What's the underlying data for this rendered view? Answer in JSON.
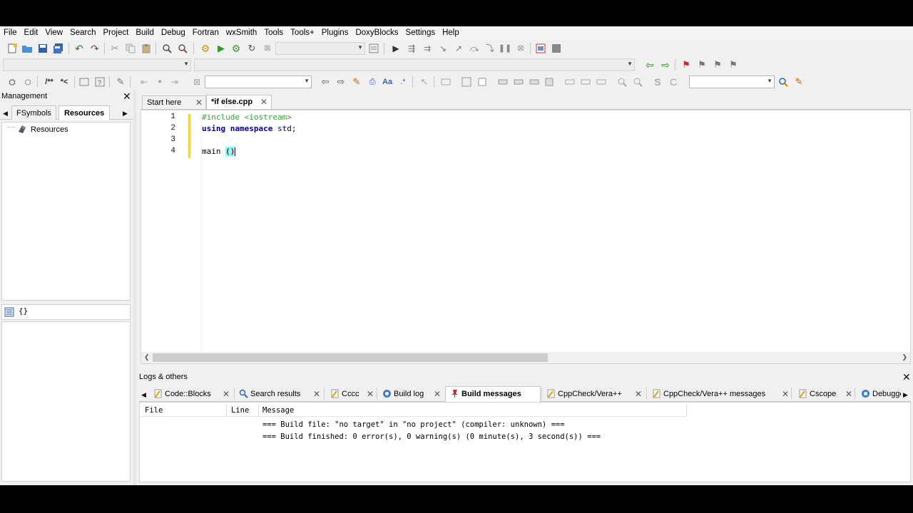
{
  "menubar": {
    "items": [
      "File",
      "Edit",
      "View",
      "Search",
      "Project",
      "Build",
      "Debug",
      "Fortran",
      "wxSmith",
      "Tools",
      "Tools+",
      "Plugins",
      "DoxyBlocks",
      "Settings",
      "Help"
    ]
  },
  "toolbar3": {
    "doxy_block_label": "/**",
    "doxy_line_label": "*<"
  },
  "management": {
    "title": "Management",
    "tab_fsymbols": "FSymbols",
    "tab_resources": "Resources",
    "tree_root": "Resources",
    "symbols_label": "{}"
  },
  "editor": {
    "tabs": [
      {
        "label": "Start here"
      },
      {
        "label": "*if else.cpp"
      }
    ],
    "line_numbers": [
      "1",
      "2",
      "3",
      "4"
    ],
    "code": {
      "line1": "#include <iostream>",
      "line2_kw1": "using",
      "line2_kw2": "namespace",
      "line2_rest": "std;",
      "line4_name": "main",
      "line4_parens": "()"
    }
  },
  "logs": {
    "title": "Logs & others",
    "tabs": [
      {
        "label": "Code::Blocks",
        "icon": "document-icon"
      },
      {
        "label": "Search results",
        "icon": "search-icon"
      },
      {
        "label": "Cccc",
        "icon": "document-icon"
      },
      {
        "label": "Build log",
        "icon": "gear-icon"
      },
      {
        "label": "Build messages",
        "icon": "pin-icon"
      },
      {
        "label": "CppCheck/Vera++",
        "icon": "document-icon"
      },
      {
        "label": "CppCheck/Vera++ messages",
        "icon": "document-icon"
      },
      {
        "label": "Cscope",
        "icon": "document-icon"
      },
      {
        "label": "Debugge",
        "icon": "gear-icon"
      }
    ],
    "columns": {
      "file": "File",
      "line": "Line",
      "message": "Message"
    },
    "messages": [
      "=== Build file: \"no target\" in \"no project\" (compiler: unknown) ===",
      "=== Build finished: 0 error(s), 0 warning(s) (0 minute(s), 3 second(s)) ==="
    ]
  },
  "colors": {
    "preprocessor": "#2fa82f",
    "keyword": "#00009a",
    "brace_highlight": "#80ffff"
  }
}
